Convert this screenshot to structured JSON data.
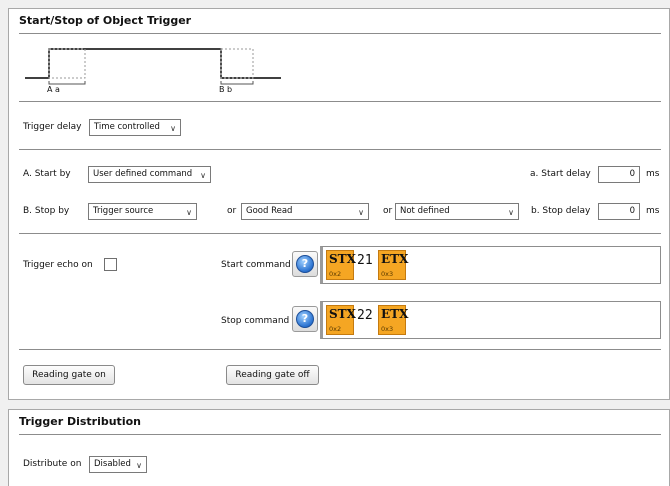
{
  "trigger_panel": {
    "title": "Start/Stop of Object Trigger",
    "diagram": {
      "label_start": "A  a",
      "label_stop": "B  b"
    },
    "trigger_delay": {
      "label": "Trigger delay",
      "value": "Time controlled"
    },
    "start_by": {
      "label": "A. Start by",
      "value": "User defined command"
    },
    "start_delay": {
      "label": "a. Start delay",
      "value": "0",
      "unit": "ms"
    },
    "stop_by": {
      "label": "B. Stop by",
      "value": "Trigger source",
      "or1": "or",
      "value2": "Good Read",
      "or2": "or",
      "value3": "Not defined"
    },
    "stop_delay": {
      "label": "b. Stop delay",
      "value": "0",
      "unit": "ms"
    },
    "trigger_echo": {
      "label": "Trigger echo on",
      "checked": false
    },
    "start_command": {
      "label": "Start command",
      "tokens": [
        {
          "text": "STX",
          "hex": "0x2"
        },
        {
          "text": "ETX",
          "hex": "0x3"
        }
      ],
      "payload": "21"
    },
    "stop_command": {
      "label": "Stop command",
      "tokens": [
        {
          "text": "STX",
          "hex": "0x2"
        },
        {
          "text": "ETX",
          "hex": "0x3"
        }
      ],
      "payload": "22"
    },
    "gate_on_button": "Reading gate on",
    "gate_off_button": "Reading gate off"
  },
  "distribution_panel": {
    "title": "Trigger Distribution",
    "distribute_on": {
      "label": "Distribute on",
      "value": "Disabled"
    }
  },
  "colors": {
    "token_bg": "#f5a623",
    "help_blue": "#2a72d0"
  },
  "icons": {
    "dropdown": "chevron-down-icon",
    "help": "help-icon"
  }
}
